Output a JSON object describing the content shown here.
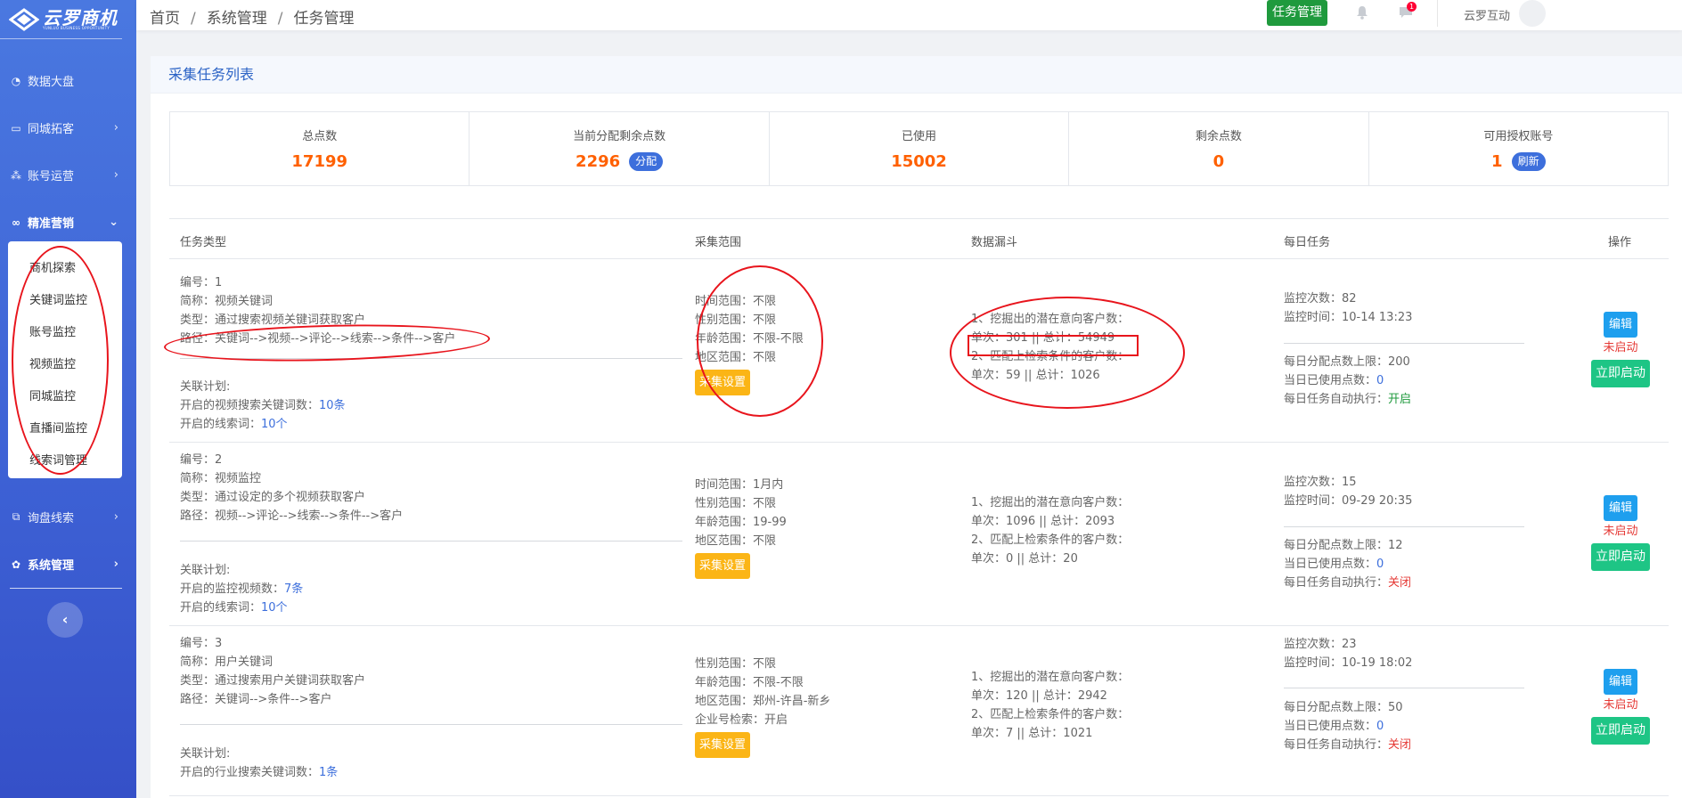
{
  "sidebar": {
    "logo_text": "云罗商机",
    "logo_sub": "YUNLUO BUSINESS OPPORTUNITY",
    "items": [
      {
        "label": "数据大盘",
        "icon": "dashboard-icon"
      },
      {
        "label": "同城拓客",
        "icon": "card-icon"
      },
      {
        "label": "账号运营",
        "icon": "nodes-icon"
      },
      {
        "label": "精准营销",
        "icon": "binoculars-icon"
      },
      {
        "label": "询盘线索",
        "icon": "sitemap-icon"
      },
      {
        "label": "系统管理",
        "icon": "gears-icon"
      }
    ],
    "submenu": [
      "商机探索",
      "关键词监控",
      "账号监控",
      "视频监控",
      "同城监控",
      "直播间监控",
      "线索词管理"
    ],
    "collapse": "‹"
  },
  "topbar": {
    "breadcrumb": [
      "首页",
      "系统管理",
      "任务管理"
    ],
    "task_button": "任务管理",
    "badge": "1",
    "user": "云罗互动"
  },
  "panel": {
    "title": "采集任务列表",
    "stats": [
      {
        "label": "总点数",
        "value": "17199"
      },
      {
        "label": "当前分配剩余点数",
        "value": "2296",
        "action": "分配"
      },
      {
        "label": "已使用",
        "value": "15002"
      },
      {
        "label": "剩余点数",
        "value": "0"
      },
      {
        "label": "可用授权账号",
        "value": "1",
        "action": "刷新"
      }
    ],
    "headers": [
      "任务类型",
      "采集范围",
      "数据漏斗",
      "每日任务",
      "操作"
    ],
    "buttons": {
      "config": "采集设置",
      "edit": "编辑",
      "start": "立即启动",
      "not_started": "未启动"
    },
    "rows": [
      {
        "id": "编号：1",
        "name": "简称：视频关键词",
        "type": "类型：通过搜索视频关键词获取客户",
        "path": "路径：关键词-->视频-->评论-->线索-->条件-->客户",
        "plan_title": "关联计划:",
        "plan1_prefix": "开启的视频搜索关键词数：",
        "plan1_val": "10条",
        "plan2_prefix": "开启的线索词：",
        "plan2_val": "10个",
        "scope": [
          "时间范围：不限",
          "性别范围：不限",
          "年龄范围：不限-不限",
          "地区范围：不限"
        ],
        "funnel": [
          "1、挖掘出的潜在意向客户数：",
          "单次：301 || 总计：54949",
          "2、匹配上检索条件的客户数：",
          "单次：59 || 总计：1026"
        ],
        "monitor_count": "监控次数：82",
        "monitor_time": "监控时间：10-14 13:23",
        "limit": "每日分配点数上限：200",
        "used_prefix": "当日已使用点数：",
        "used_val": "0",
        "auto_prefix": "每日任务自动执行：",
        "auto_val": "开启",
        "auto_on": true
      },
      {
        "id": "编号：2",
        "name": "简称：视频监控",
        "type": "类型：通过设定的多个视频获取客户",
        "path": "路径：视频-->评论-->线索-->条件-->客户",
        "plan_title": "关联计划:",
        "plan1_prefix": "开启的监控视频数：",
        "plan1_val": "7条",
        "plan2_prefix": "开启的线索词：",
        "plan2_val": "10个",
        "scope": [
          "时间范围：1月内",
          "性别范围：不限",
          "年龄范围：19-99",
          "地区范围：不限"
        ],
        "funnel": [
          "1、挖掘出的潜在意向客户数：",
          "单次：1096 || 总计：2093",
          "2、匹配上检索条件的客户数：",
          "单次：0 || 总计：20"
        ],
        "monitor_count": "监控次数：15",
        "monitor_time": "监控时间：09-29 20:35",
        "limit": "每日分配点数上限：12",
        "used_prefix": "当日已使用点数：",
        "used_val": "0",
        "auto_prefix": "每日任务自动执行：",
        "auto_val": "关闭",
        "auto_on": false
      },
      {
        "id": "编号：3",
        "name": "简称：用户关键词",
        "type": "类型：通过搜索用户关键词获取客户",
        "path": "路径：关键词-->条件-->客户",
        "plan_title": "关联计划:",
        "plan1_prefix": "开启的行业搜索关键词数：",
        "plan1_val": "1条",
        "scope": [
          "性别范围：不限",
          "年龄范围：不限-不限",
          "地区范围：郑州-许昌-新乡",
          "企业号检索：开启"
        ],
        "funnel": [
          "1、挖掘出的潜在意向客户数：",
          "单次：120 || 总计：2942",
          "2、匹配上检索条件的客户数：",
          "单次：7 || 总计：1021"
        ],
        "monitor_count": "监控次数：23",
        "monitor_time": "监控时间：10-19 18:02",
        "limit": "每日分配点数上限：50",
        "used_prefix": "当日已使用点数：",
        "used_val": "0",
        "auto_prefix": "每日任务自动执行：",
        "auto_val": "关闭",
        "auto_on": false
      }
    ]
  },
  "colors": {
    "accent": "#3d6fdc",
    "orange": "#ff6000",
    "green": "#1f9a3d",
    "red": "#e53935",
    "annotation": "#e8141c"
  }
}
